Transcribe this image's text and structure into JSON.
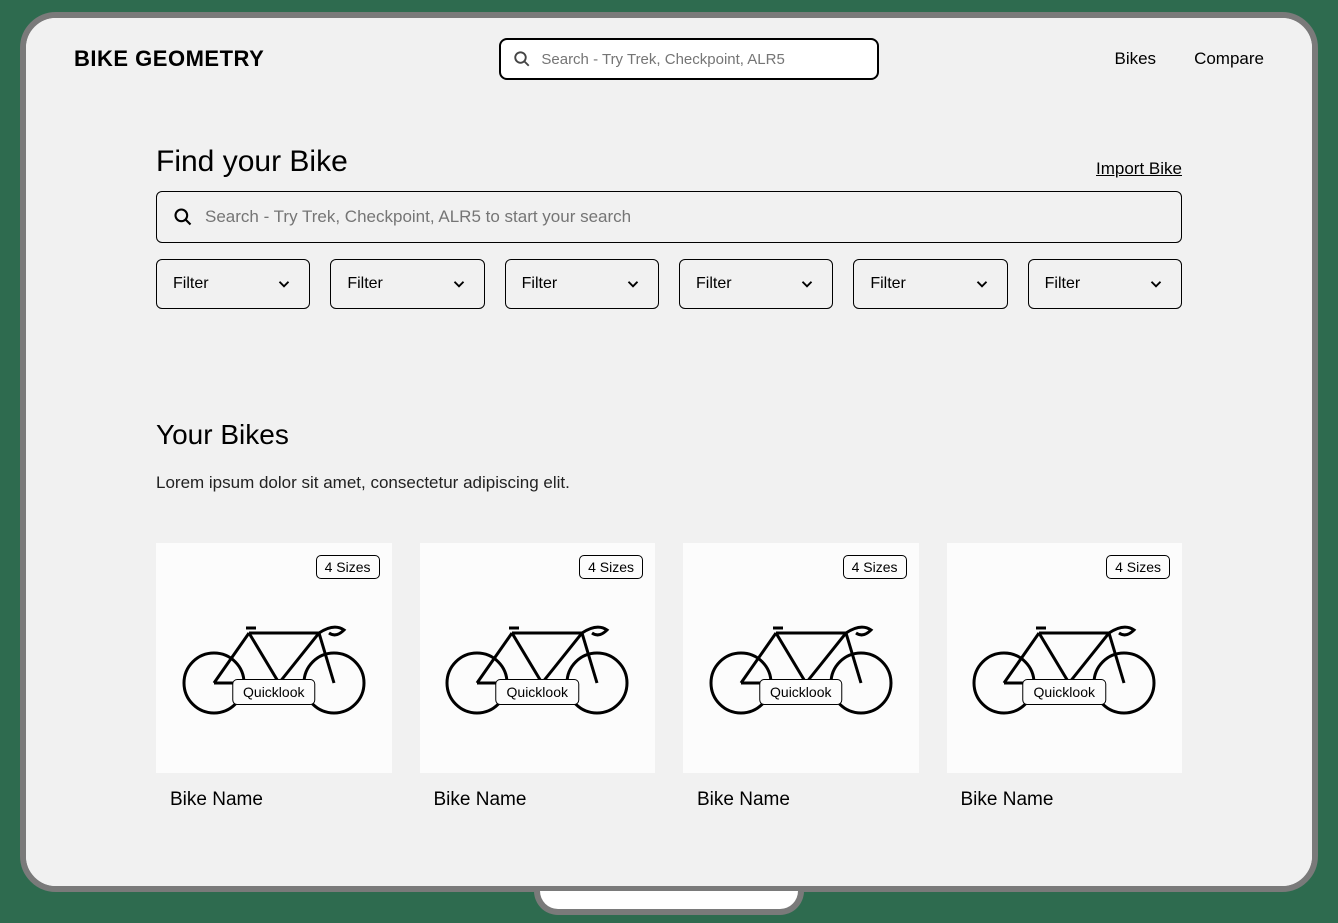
{
  "header": {
    "logo": "BIKE GEOMETRY",
    "search_placeholder": "Search - Try Trek, Checkpoint, ALR5",
    "nav": {
      "bikes": "Bikes",
      "compare": "Compare"
    }
  },
  "find": {
    "title": "Find your Bike",
    "import_link": "Import Bike",
    "search_placeholder": "Search - Try Trek, Checkpoint, ALR5 to start your search",
    "filters": [
      "Filter",
      "Filter",
      "Filter",
      "Filter",
      "Filter",
      "Filter"
    ]
  },
  "your_bikes": {
    "title": "Your Bikes",
    "desc": "Lorem ipsum dolor sit amet, consectetur adipiscing elit.",
    "cards": [
      {
        "sizes": "4 Sizes",
        "quicklook": "Quicklook",
        "name": "Bike Name"
      },
      {
        "sizes": "4 Sizes",
        "quicklook": "Quicklook",
        "name": "Bike Name"
      },
      {
        "sizes": "4 Sizes",
        "quicklook": "Quicklook",
        "name": "Bike Name"
      },
      {
        "sizes": "4 Sizes",
        "quicklook": "Quicklook",
        "name": "Bike Name"
      }
    ]
  }
}
